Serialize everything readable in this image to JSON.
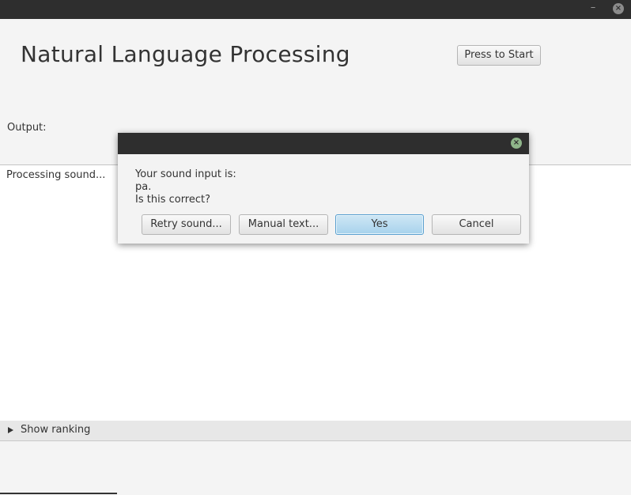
{
  "window": {
    "minimize_glyph": "–",
    "close_glyph": "×"
  },
  "app": {
    "title": "Natural Language Processing",
    "start_button": "Press to Start",
    "output_label": "Output:",
    "output_text": "Processing sound...",
    "ranking_label": "Show ranking"
  },
  "dialog": {
    "close_glyph": "×",
    "message": {
      "line1": "Your sound input is:",
      "line2": "pa.",
      "line3": "Is this correct?"
    },
    "buttons": {
      "retry": "Retry sound...",
      "manual": "Manual text...",
      "yes": "Yes",
      "cancel": "Cancel"
    }
  },
  "colors": {
    "titlebar": "#2e2e2e",
    "window_bg": "#f4f4f4",
    "default_button": "#a7d2ec",
    "dialog_close": "#8fb58a"
  }
}
